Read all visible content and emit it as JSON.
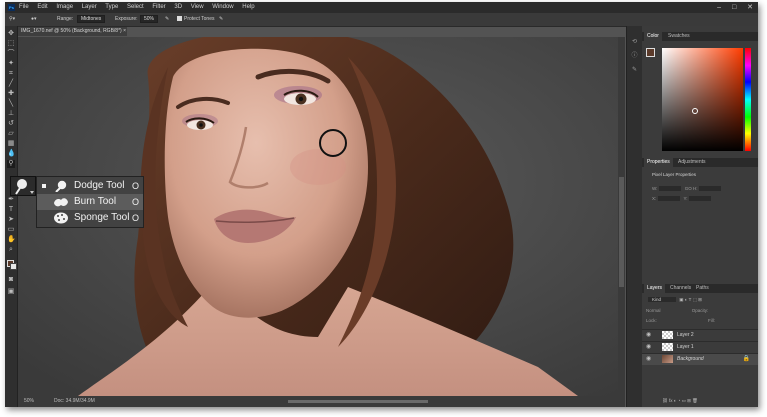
{
  "app": {
    "logo_text": "Ps",
    "menu": [
      "File",
      "Edit",
      "Image",
      "Layer",
      "Type",
      "Select",
      "Filter",
      "3D",
      "View",
      "Window",
      "Help"
    ],
    "window_controls": [
      "–",
      "□",
      "✕"
    ]
  },
  "options_bar": {
    "range_label": "Range:",
    "range_value": "Midtones",
    "exposure_label": "Exposure:",
    "exposure_value": "50%",
    "protect_tones_label": "Protect Tones"
  },
  "document": {
    "tab_title": "IMG_1670.nef @ 50% (Background, RGB/8*) ×",
    "zoom": "50%",
    "doc_info": "Doc: 34.9M/34.9M"
  },
  "flyout": {
    "items": [
      {
        "label": "Dodge Tool",
        "key": "O",
        "icon": "dodge-icon",
        "selected": true
      },
      {
        "label": "Burn Tool",
        "key": "O",
        "icon": "burn-icon",
        "selected": false
      },
      {
        "label": "Sponge Tool",
        "key": "O",
        "icon": "sponge-icon",
        "selected": false
      }
    ]
  },
  "color_panel": {
    "tabs": [
      "Color",
      "Swatches"
    ],
    "foreground": "#5b3a2a"
  },
  "properties_panel": {
    "tabs": [
      "Properties",
      "Adjustments"
    ],
    "title": "Pixel Layer Properties",
    "w_label": "W:",
    "h_label": "H:",
    "x_label": "X:",
    "y_label": "Y:",
    "go_label": "GO"
  },
  "layers_panel": {
    "tabs": [
      "Layers",
      "Channels",
      "Paths"
    ],
    "filter_label": "Kind",
    "blend_mode": "Normal",
    "opacity_label": "Opacity:",
    "fill_label": "Fill:",
    "lock_label": "Lock:",
    "layers": [
      {
        "name": "Layer 2",
        "type": "transparent"
      },
      {
        "name": "Layer 1",
        "type": "transparent"
      },
      {
        "name": "Background",
        "type": "image",
        "locked": true
      }
    ]
  }
}
